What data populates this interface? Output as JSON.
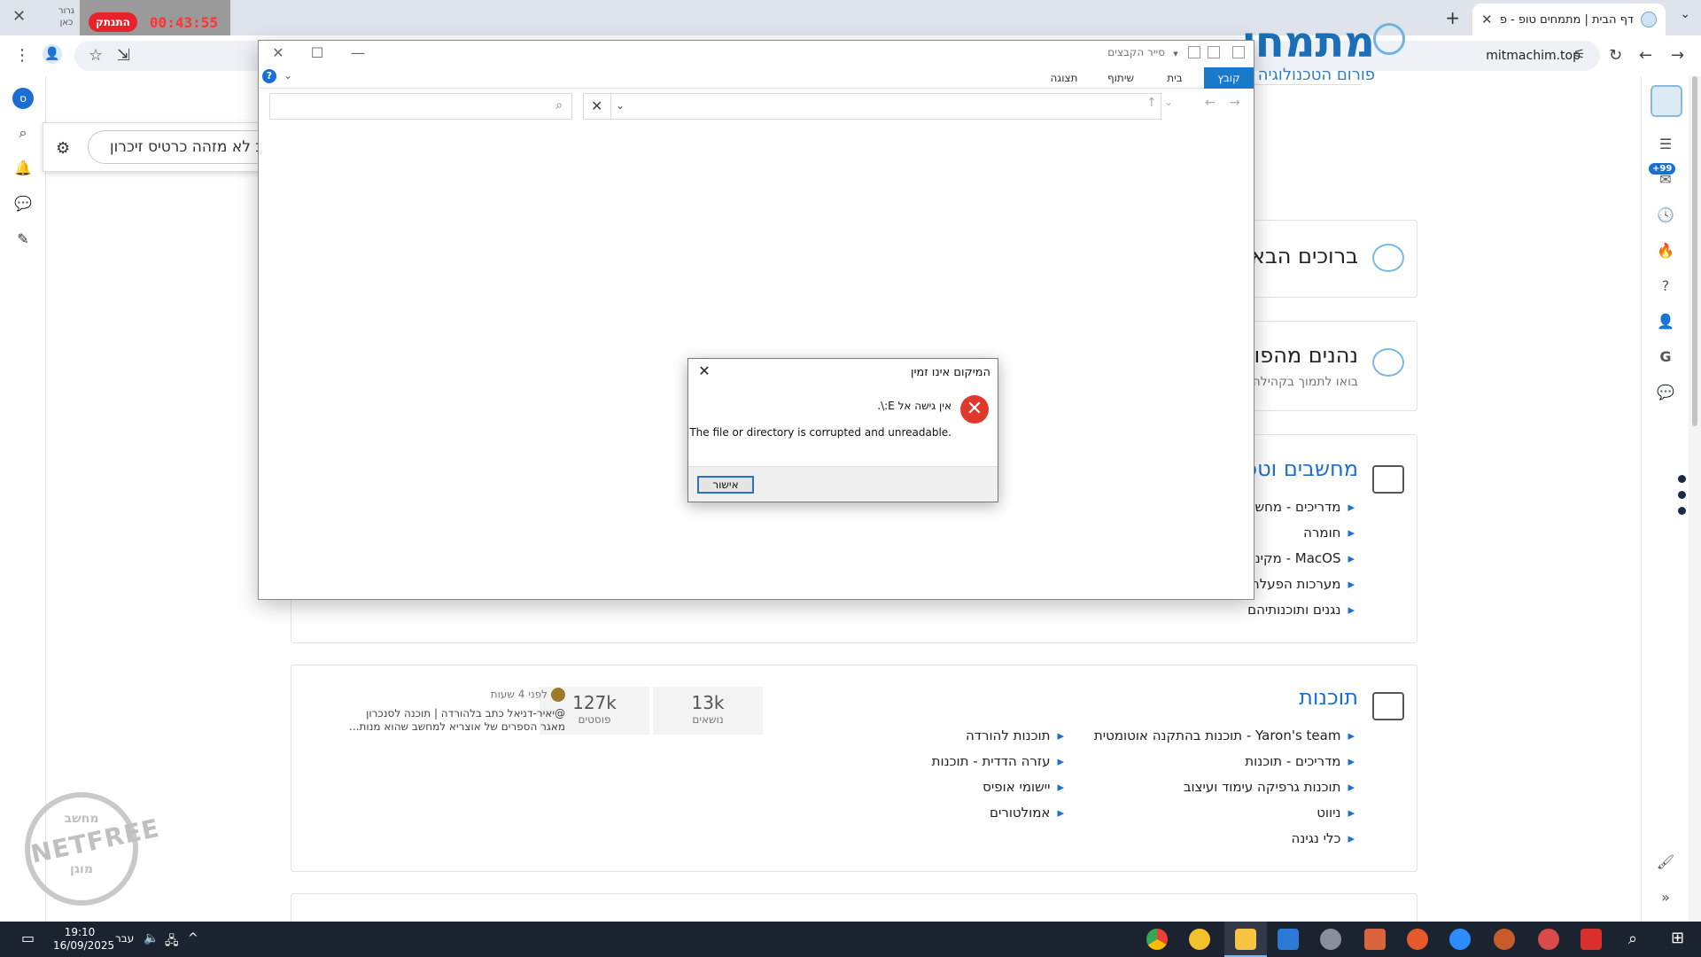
{
  "browser": {
    "tab_title": "דף הבית | מתמחים טופ - פורום",
    "url": "mitmachim.top",
    "timer_button": "התנתק",
    "timer_time": "00:43:55",
    "timer_side": "גרור כאן"
  },
  "search_popup": {
    "text": "ב לא מזהה כרטיס זיכרון"
  },
  "forum": {
    "logo_main": "מתמחי",
    "logo_sub": "פורום הטכנולוגיה של",
    "welcome_title": "ברוכים הבא",
    "enjoy_title": "נהנים מהפו",
    "enjoy_sub": "בואו לתמוך בקהילה של",
    "computers_title": "מחשבים וטכ",
    "computers_links": [
      "מדריכים - מחשב",
      "חומרה",
      "MacOS - מקינטו",
      "מערכות הפעלה",
      "נגנים ותוכנותיהם"
    ],
    "software_title": "תוכנות",
    "software_links_right": [
      "Yaron's team - תוכנות בהתקנה אוטומטית",
      "מדריכים - תוכנות",
      "תוכנות גרפיקה עימוד ועיצוב",
      "ניווט",
      "כלי נגינה"
    ],
    "software_links_left": [
      "תוכנות להורדה",
      "עזרה הדדית - תוכנות",
      "יישומי אופיס",
      "אמולטורים"
    ],
    "topics_num": "13k",
    "topics_lbl": "נושאים",
    "posts_num": "127k",
    "posts_lbl": "פוסטים",
    "last_post_time": "לפני 4 שעות",
    "last_post_line1": "@יאיר-דניאל כתב בלהורדה | תוכנה לסנכרון",
    "last_post_line2": "מאגר הספרים של אוצריא למחשב שהוא מנות...",
    "netfree_top": "מחשב",
    "netfree_mid": "NETFREE",
    "netfree_bot": "מוגן"
  },
  "explorer": {
    "title": "סייר הקבצים",
    "tabs": [
      "קובץ",
      "בית",
      "שיתוף",
      "תצוגה"
    ]
  },
  "dialog": {
    "title": "המיקום אינו זמין",
    "message1": "אין גישה אל E:\\.",
    "message2": "The file or directory is corrupted and unreadable.",
    "ok": "אישור"
  },
  "right_sidebar": {
    "badge": "+99"
  },
  "left_sidebar": {
    "avatar_letter": "ס"
  },
  "taskbar": {
    "time": "19:10",
    "date": "16/09/2025",
    "lang": "עבר"
  },
  "colors": {
    "accent": "#1b6fd3",
    "error": "#e0392b",
    "taskbar": "#1c2330"
  }
}
